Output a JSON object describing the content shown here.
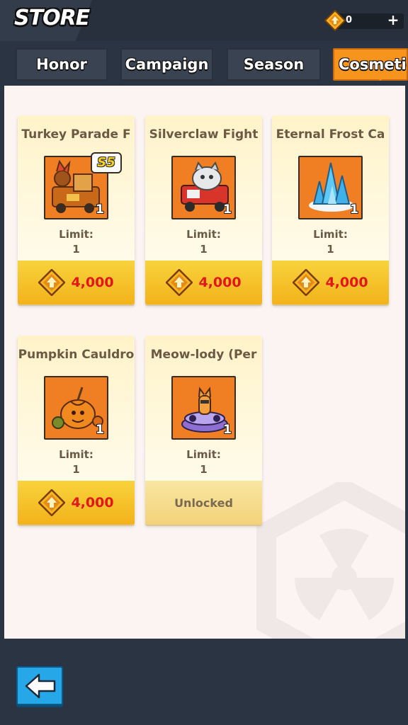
{
  "header": {
    "title": "STORE",
    "currency": {
      "value": "0",
      "add_label": "+",
      "icon": "gem-coin-icon"
    }
  },
  "tabs": [
    {
      "label": "Honor",
      "active": false
    },
    {
      "label": "Campaign",
      "active": false
    },
    {
      "label": "Season",
      "active": false
    },
    {
      "label": "Cosmetic",
      "active": true
    }
  ],
  "items": [
    {
      "name": "Turkey Parade F",
      "quantity": "1",
      "badge": "S5",
      "limit_label": "Limit:",
      "limit": "1",
      "price": "4,000",
      "unlocked": false,
      "icon": "turkey-parade-float-icon"
    },
    {
      "name": "Silverclaw Fight",
      "quantity": "1",
      "limit_label": "Limit:",
      "limit": "1",
      "price": "4,000",
      "unlocked": false,
      "icon": "silverclaw-fire-truck-icon"
    },
    {
      "name": "Eternal Frost Ca",
      "quantity": "1",
      "limit_label": "Limit:",
      "limit": "1",
      "price": "4,000",
      "unlocked": false,
      "icon": "eternal-frost-castle-icon"
    },
    {
      "name": "Pumpkin Cauldro",
      "quantity": "1",
      "limit_label": "Limit:",
      "limit": "1",
      "price": "4,000",
      "unlocked": false,
      "icon": "pumpkin-cauldron-icon"
    },
    {
      "name": "Meow-lody (Per",
      "quantity": "1",
      "limit_label": "Limit:",
      "limit": "1",
      "status": "Unlocked",
      "unlocked": true,
      "icon": "meow-lody-dj-cat-icon"
    }
  ],
  "footer": {
    "back_icon": "back-arrow-icon"
  },
  "colors": {
    "accent": "#f7941d",
    "price": "#e2161b",
    "tab_bg": "#394352",
    "back_button": "#26a7e8"
  }
}
